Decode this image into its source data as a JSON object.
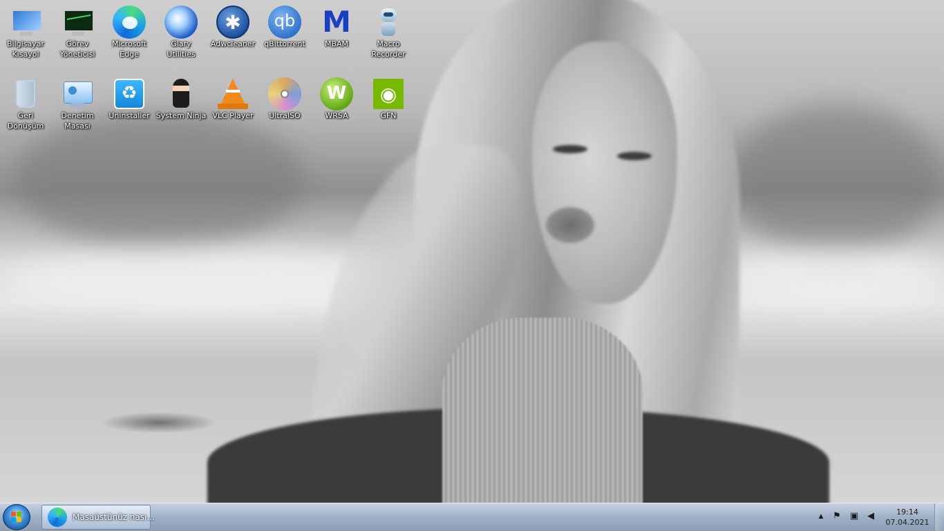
{
  "desktop": {
    "icons": [
      {
        "label": "Bilgisayar Kısayol",
        "icon": "computer-icon"
      },
      {
        "label": "Görev Yöneticisi",
        "icon": "task-manager-icon"
      },
      {
        "label": "Microsoft Edge",
        "icon": "edge-icon"
      },
      {
        "label": "Glary Utilities",
        "icon": "glary-utilities-icon"
      },
      {
        "label": "Adwcleaner",
        "icon": "adwcleaner-icon"
      },
      {
        "label": "qBittorrent",
        "icon": "qbittorrent-icon"
      },
      {
        "label": "MBAM",
        "icon": "malwarebytes-icon"
      },
      {
        "label": "Macro Recorder",
        "icon": "macro-recorder-icon"
      },
      {
        "label": "Geri Dönüşüm",
        "icon": "recycle-bin-icon"
      },
      {
        "label": "Denetim Masası",
        "icon": "control-panel-icon"
      },
      {
        "label": "Uninstaller",
        "icon": "uninstaller-icon"
      },
      {
        "label": "System Ninja",
        "icon": "system-ninja-icon"
      },
      {
        "label": "VLC Player",
        "icon": "vlc-icon"
      },
      {
        "label": "UltraISO",
        "icon": "ultraiso-icon"
      },
      {
        "label": "WRSA",
        "icon": "wrsa-icon"
      },
      {
        "label": "GFN",
        "icon": "nvidia-gfn-icon"
      }
    ]
  },
  "taskbar": {
    "start_icon": "windows-start-icon",
    "open_window": {
      "label": "Masaüstünüz nası...",
      "icon": "edge-icon"
    },
    "tray": {
      "icons": [
        "show-hidden-icons-arrow",
        "action-center-icon",
        "network-icon",
        "volume-icon"
      ]
    },
    "clock": {
      "time": "19:14",
      "date": "07.04.2021"
    }
  },
  "colors": {
    "taskbar": "#a8b8cc",
    "label_text": "#ffffff"
  }
}
